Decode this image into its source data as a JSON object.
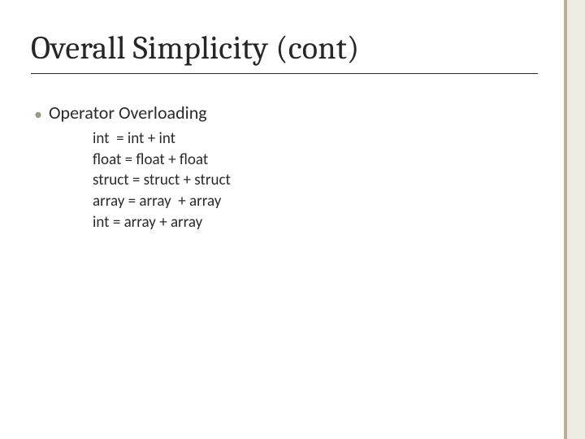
{
  "slide": {
    "title": "Overall Simplicity (cont)",
    "bullet": {
      "marker": "•",
      "text": "Operator Overloading"
    },
    "examples": [
      "int  = int + int",
      "float = float + float",
      "struct = struct + struct",
      "array = array  + array",
      "int = array + array"
    ]
  }
}
